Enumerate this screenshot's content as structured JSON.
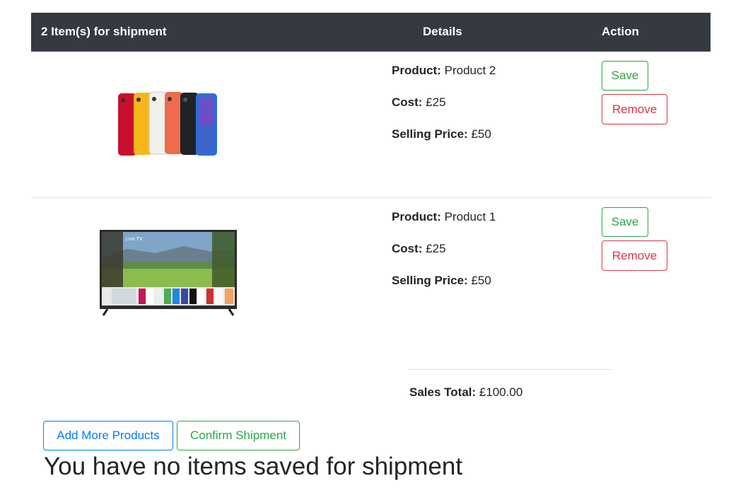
{
  "table": {
    "header_items": "2 Item(s) for shipment",
    "header_details": "Details",
    "header_action": "Action"
  },
  "items": [
    {
      "image": "iphone-xr-lineup",
      "product_label": "Product:",
      "product_value": "Product 2",
      "cost_label": "Cost:",
      "cost_value": "£25",
      "price_label": "Selling Price:",
      "price_value": "£50",
      "save_label": "Save",
      "remove_label": "Remove"
    },
    {
      "image": "smart-tv",
      "product_label": "Product:",
      "product_value": "Product 1",
      "cost_label": "Cost:",
      "cost_value": "£25",
      "price_label": "Selling Price:",
      "price_value": "£50",
      "save_label": "Save",
      "remove_label": "Remove"
    }
  ],
  "summary": {
    "total_label": "Sales Total:",
    "total_value": "£100.00"
  },
  "actions": {
    "add_more_label": "Add More Products",
    "confirm_label": "Confirm Shipment"
  },
  "empty_message": "You have no items saved for shipment",
  "tv_screen_text": "Live TV",
  "colors": {
    "header_bg": "#343a40",
    "success": "#28a745",
    "danger": "#dc3545",
    "primary": "#007bff"
  }
}
